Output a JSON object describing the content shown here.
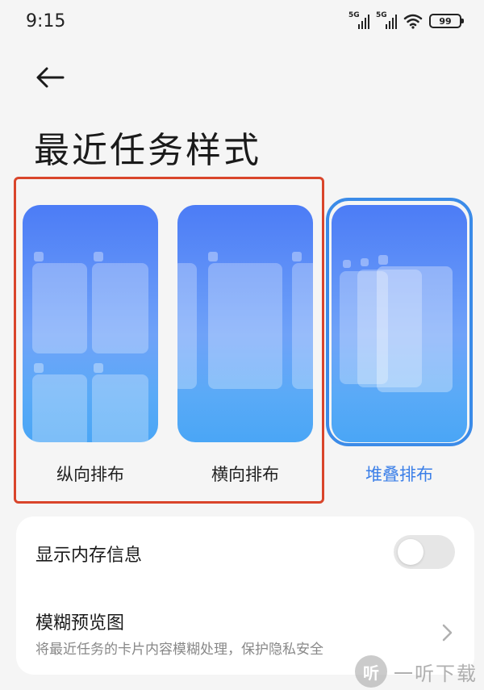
{
  "status_bar": {
    "time": "9:15",
    "signal1_label": "5G",
    "signal2_label": "5G",
    "battery": "99"
  },
  "header": {
    "back_icon": "arrow-left-icon",
    "title": "最近任务样式"
  },
  "styles": {
    "options": [
      {
        "label": "纵向排布",
        "selected": false
      },
      {
        "label": "横向排布",
        "selected": false
      },
      {
        "label": "堆叠排布",
        "selected": true
      }
    ]
  },
  "settings": {
    "memory": {
      "title": "显示内存信息",
      "enabled": false
    },
    "blur": {
      "title": "模糊预览图",
      "subtitle": "将最近任务的卡片内容模糊处理，保护隐私安全"
    }
  },
  "watermark": {
    "logo": "听",
    "text": "一听下载"
  },
  "colors": {
    "accent": "#3b7fe8",
    "highlight": "#d9452b",
    "background": "#f5f5f5"
  }
}
